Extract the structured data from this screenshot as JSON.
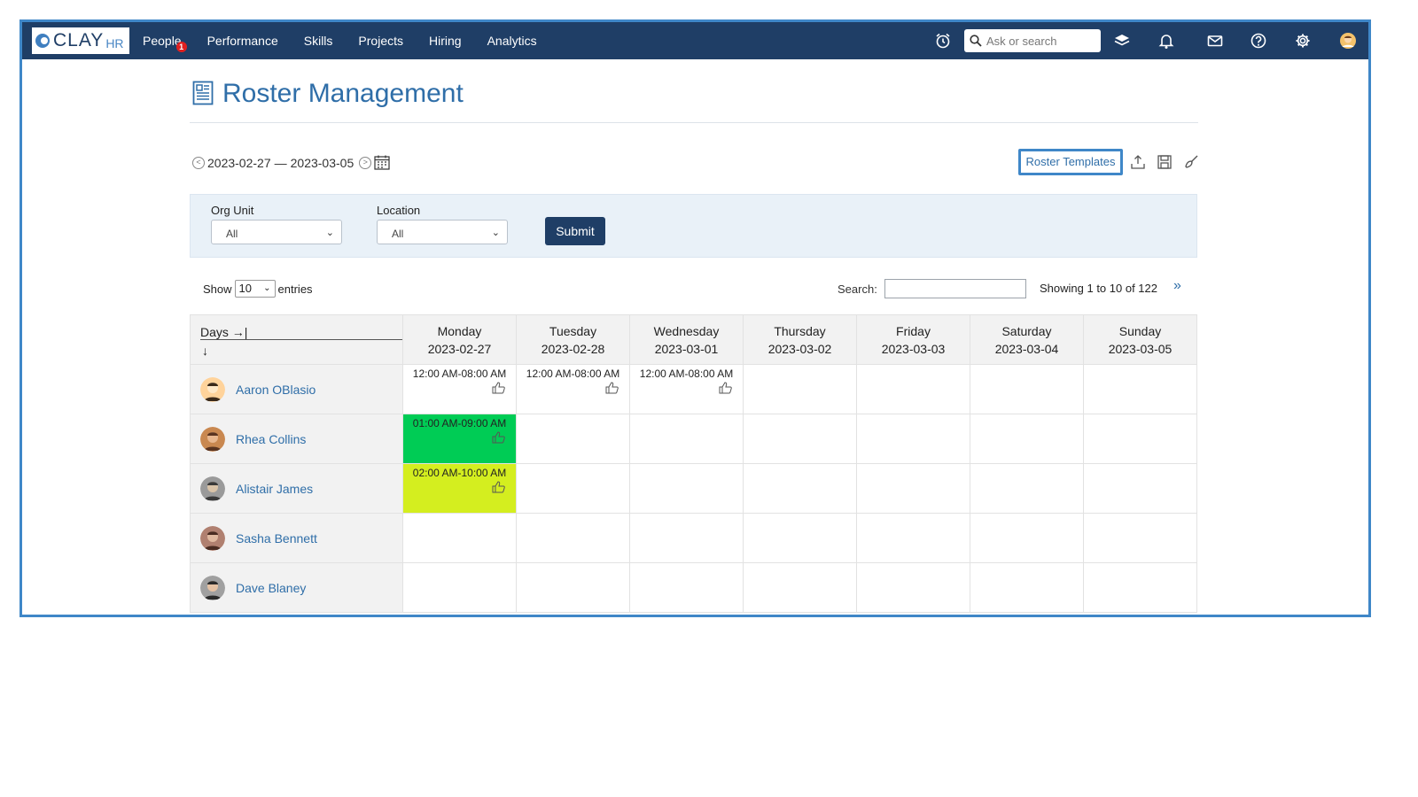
{
  "app": {
    "logo_text": "CLAY",
    "logo_suffix": "HR"
  },
  "nav": [
    {
      "label": "People",
      "badge": "1"
    },
    {
      "label": "Performance"
    },
    {
      "label": "Skills"
    },
    {
      "label": "Projects"
    },
    {
      "label": "Hiring"
    },
    {
      "label": "Analytics"
    }
  ],
  "top": {
    "search_placeholder": "Ask or search",
    "icons": [
      "alarm-icon",
      "search-icon",
      "layers-icon",
      "bell-icon",
      "mail-icon",
      "help-icon",
      "gear-icon",
      "user-avatar"
    ]
  },
  "page": {
    "title": "Roster Management"
  },
  "date_range": {
    "start": "2023-02-27",
    "separator": "—",
    "end": "2023-03-05"
  },
  "actions": {
    "roster_templates": "Roster Templates"
  },
  "filters": {
    "org_unit_label": "Org Unit",
    "org_unit_value": "All",
    "location_label": "Location",
    "location_value": "All",
    "submit_label": "Submit"
  },
  "table_controls": {
    "show_prefix": "Show",
    "show_value": "10",
    "show_suffix": "entries",
    "search_label": "Search:",
    "showing": "Showing 1 to 10 of 122",
    "next_glyph": "»"
  },
  "grid": {
    "corner_label": "Days →|",
    "corner_down": "↓",
    "days": [
      {
        "name": "Monday",
        "date": "2023-02-27"
      },
      {
        "name": "Tuesday",
        "date": "2023-02-28"
      },
      {
        "name": "Wednesday",
        "date": "2023-03-01"
      },
      {
        "name": "Thursday",
        "date": "2023-03-02"
      },
      {
        "name": "Friday",
        "date": "2023-03-03"
      },
      {
        "name": "Saturday",
        "date": "2023-03-04"
      },
      {
        "name": "Sunday",
        "date": "2023-03-05"
      }
    ],
    "rows": [
      {
        "name": "Aaron OBlasio",
        "shifts": [
          "12:00 AM-08:00 AM",
          "12:00 AM-08:00 AM",
          "12:00 AM-08:00 AM",
          "",
          "",
          "",
          ""
        ]
      },
      {
        "name": "Rhea Collins",
        "shifts": [
          "01:00 AM-09:00 AM",
          "",
          "",
          "",
          "",
          "",
          ""
        ]
      },
      {
        "name": "Alistair James",
        "shifts": [
          "02:00 AM-10:00 AM",
          "",
          "",
          "",
          "",
          "",
          ""
        ]
      },
      {
        "name": "Sasha Bennett",
        "shifts": [
          "",
          "",
          "",
          "",
          "",
          "",
          ""
        ]
      },
      {
        "name": "Dave Blaney",
        "shifts": [
          "",
          "",
          "",
          "",
          "",
          "",
          ""
        ]
      }
    ]
  },
  "colors": {
    "nav_bg": "#1f3e66",
    "accent": "#2f6ea8",
    "shift_green": "#00cc55",
    "shift_lime": "#d4ee1f"
  }
}
